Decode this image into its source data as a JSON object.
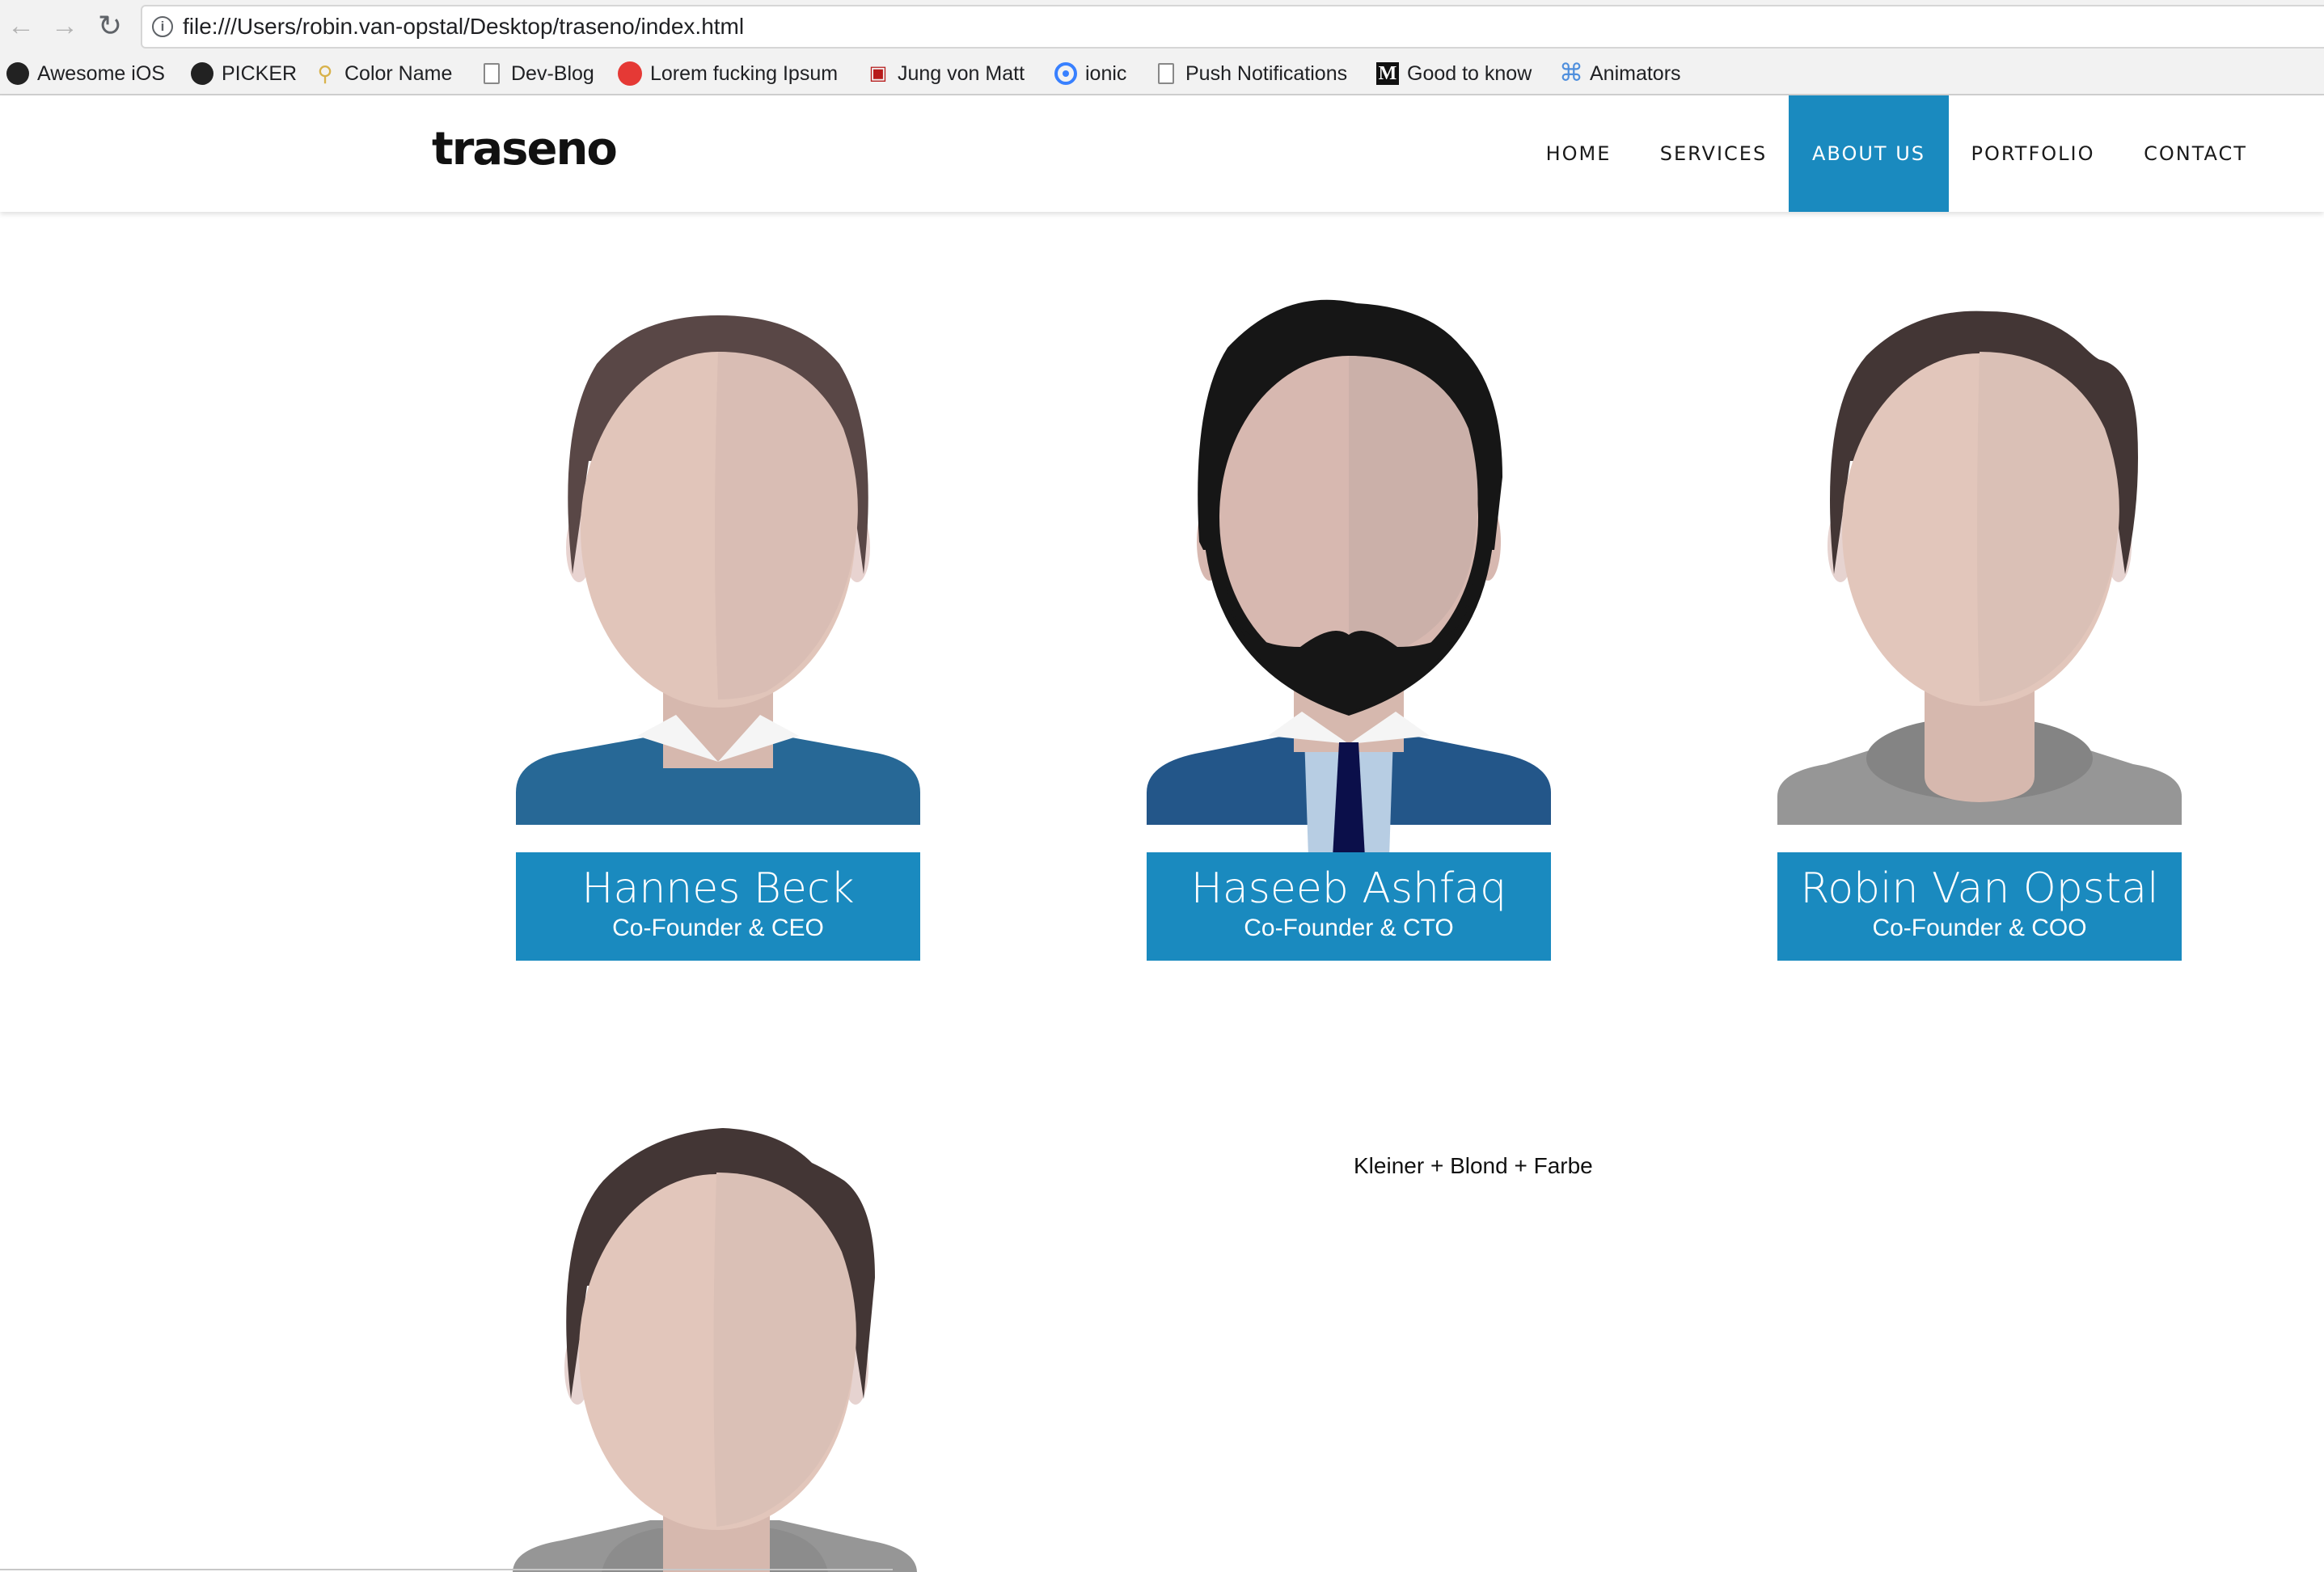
{
  "browser": {
    "url": "file:///Users/robin.van-opstal/Desktop/traseno/index.html",
    "nav_icons": {
      "back": "back-arrow-icon",
      "forward": "forward-arrow-icon",
      "reload": "reload-icon"
    },
    "bookmarks": [
      {
        "label": "Awesome iOS",
        "icon": "github-icon"
      },
      {
        "label": "PICKER",
        "icon": "github-icon"
      },
      {
        "label": "Color Name",
        "icon": "lightbulb-icon"
      },
      {
        "label": "Dev-Blog",
        "icon": "page-icon"
      },
      {
        "label": "Lorem fucking Ipsum",
        "icon": "red-dot-icon"
      },
      {
        "label": "Jung von Matt",
        "icon": "jvm-icon"
      },
      {
        "label": "ionic",
        "icon": "ionic-icon"
      },
      {
        "label": "Push Notifications",
        "icon": "page-icon"
      },
      {
        "label": "Good to know",
        "icon": "medium-icon"
      },
      {
        "label": "Animators",
        "icon": "command-icon"
      }
    ]
  },
  "site": {
    "logo": "traseno",
    "accent_color": "#1a8abf",
    "nav": [
      {
        "label": "HOME",
        "active": false
      },
      {
        "label": "SERVICES",
        "active": false
      },
      {
        "label": "ABOUT US",
        "active": true
      },
      {
        "label": "PORTFOLIO",
        "active": false
      },
      {
        "label": "CONTACT",
        "active": false
      }
    ]
  },
  "team": [
    {
      "name": "Hannes Beck",
      "role": "Co-Founder & CEO",
      "avatar": "avatar-collar-sweater"
    },
    {
      "name": "Haseeb Ashfaq",
      "role": "Co-Founder & CTO",
      "avatar": "avatar-beard-suit"
    },
    {
      "name": "Robin Van Opstal",
      "role": "Co-Founder & COO",
      "avatar": "avatar-grey-shirt"
    }
  ],
  "note": "Kleiner + Blond + Farbe"
}
